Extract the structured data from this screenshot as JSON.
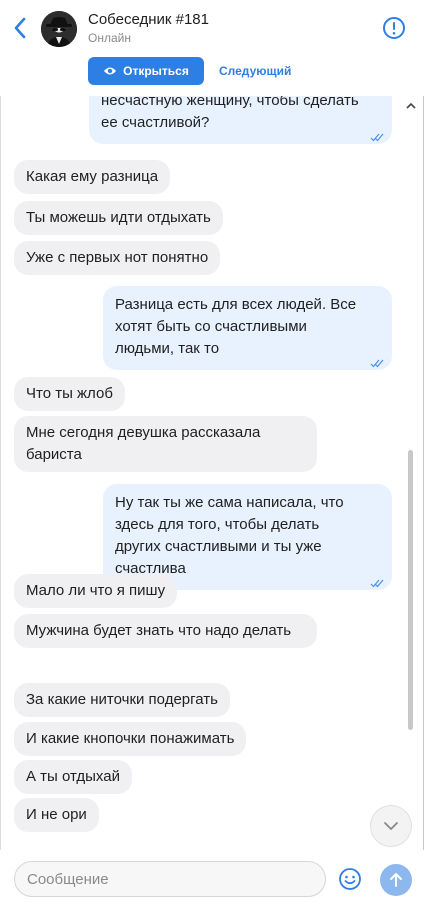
{
  "header": {
    "title": "Собеседник #181",
    "status": "Онлайн",
    "open_label": "Открыться",
    "next_label": "Следующий"
  },
  "messages": [
    {
      "dir": "out",
      "text": "несчастную женщину, чтобы сделать ее счастливой?",
      "read": true
    },
    {
      "dir": "in",
      "text": "Какая ему разница"
    },
    {
      "dir": "in",
      "text": "Ты можешь идти отдыхать"
    },
    {
      "dir": "in",
      "text": "Уже с первых нот понятно"
    },
    {
      "dir": "out",
      "text": "Разница есть для всех людей. Все хотят быть со счастливыми людьми, так то",
      "read": true
    },
    {
      "dir": "in",
      "text": "Что ты жлоб"
    },
    {
      "dir": "in",
      "text": "Мне сегодня девушка рассказала бариста"
    },
    {
      "dir": "out",
      "text": "Ну так ты же сама написала, что здесь для того, чтобы делать других счастливыми и ты уже счастлива",
      "read": true
    },
    {
      "dir": "in",
      "text": "Мало ли что я пишу"
    },
    {
      "dir": "in",
      "text": "Мужчина будет знать что надо делать"
    },
    {
      "dir": "in",
      "text": "За какие ниточки подергать"
    },
    {
      "dir": "in",
      "text": "И какие кнопочки понажимать"
    },
    {
      "dir": "in",
      "text": "А ты отдыхай"
    },
    {
      "dir": "in",
      "text": "И не ори"
    }
  ],
  "composer": {
    "placeholder": "Сообщение"
  },
  "colors": {
    "accent": "#2e7fe3",
    "incoming_bubble": "#f0f0f2",
    "outgoing_bubble": "#e8f2fe"
  }
}
